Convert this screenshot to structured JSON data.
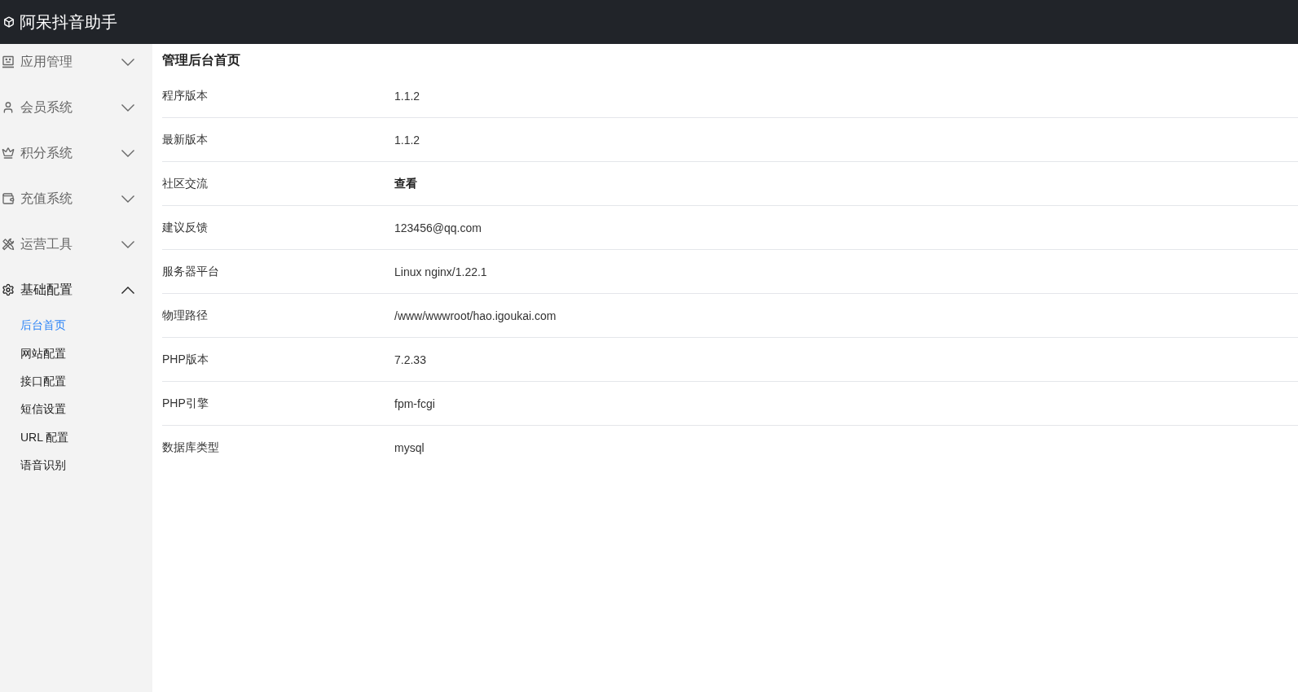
{
  "app": {
    "title": "阿呆抖音助手"
  },
  "sidebar": {
    "groups": [
      {
        "label": "应用管理",
        "expanded": false
      },
      {
        "label": "会员系统",
        "expanded": false
      },
      {
        "label": "积分系统",
        "expanded": false
      },
      {
        "label": "充值系统",
        "expanded": false
      },
      {
        "label": "运营工具",
        "expanded": false
      },
      {
        "label": "基础配置",
        "expanded": true,
        "children": [
          {
            "label": "后台首页",
            "selected": true
          },
          {
            "label": "网站配置",
            "selected": false
          },
          {
            "label": "接口配置",
            "selected": false
          },
          {
            "label": "短信设置",
            "selected": false
          },
          {
            "label": "URL 配置",
            "selected": false
          },
          {
            "label": "语音识别",
            "selected": false
          }
        ]
      }
    ]
  },
  "page": {
    "title": "管理后台首页",
    "rows": [
      {
        "label": "程序版本",
        "value": "1.1.2",
        "kind": "text"
      },
      {
        "label": "最新版本",
        "value": "1.1.2",
        "kind": "text"
      },
      {
        "label": "社区交流",
        "value": "查看",
        "kind": "link"
      },
      {
        "label": "建议反馈",
        "value": "123456@qq.com",
        "kind": "text"
      },
      {
        "label": "服务器平台",
        "value": "Linux nginx/1.22.1",
        "kind": "text"
      },
      {
        "label": "物理路径",
        "value": "/www/wwwroot/hao.igoukai.com",
        "kind": "text"
      },
      {
        "label": "PHP版本",
        "value": "7.2.33",
        "kind": "text"
      },
      {
        "label": "PHP引擎",
        "value": "fpm-fcgi",
        "kind": "text"
      },
      {
        "label": "数据库类型",
        "value": "mysql",
        "kind": "text"
      }
    ]
  }
}
